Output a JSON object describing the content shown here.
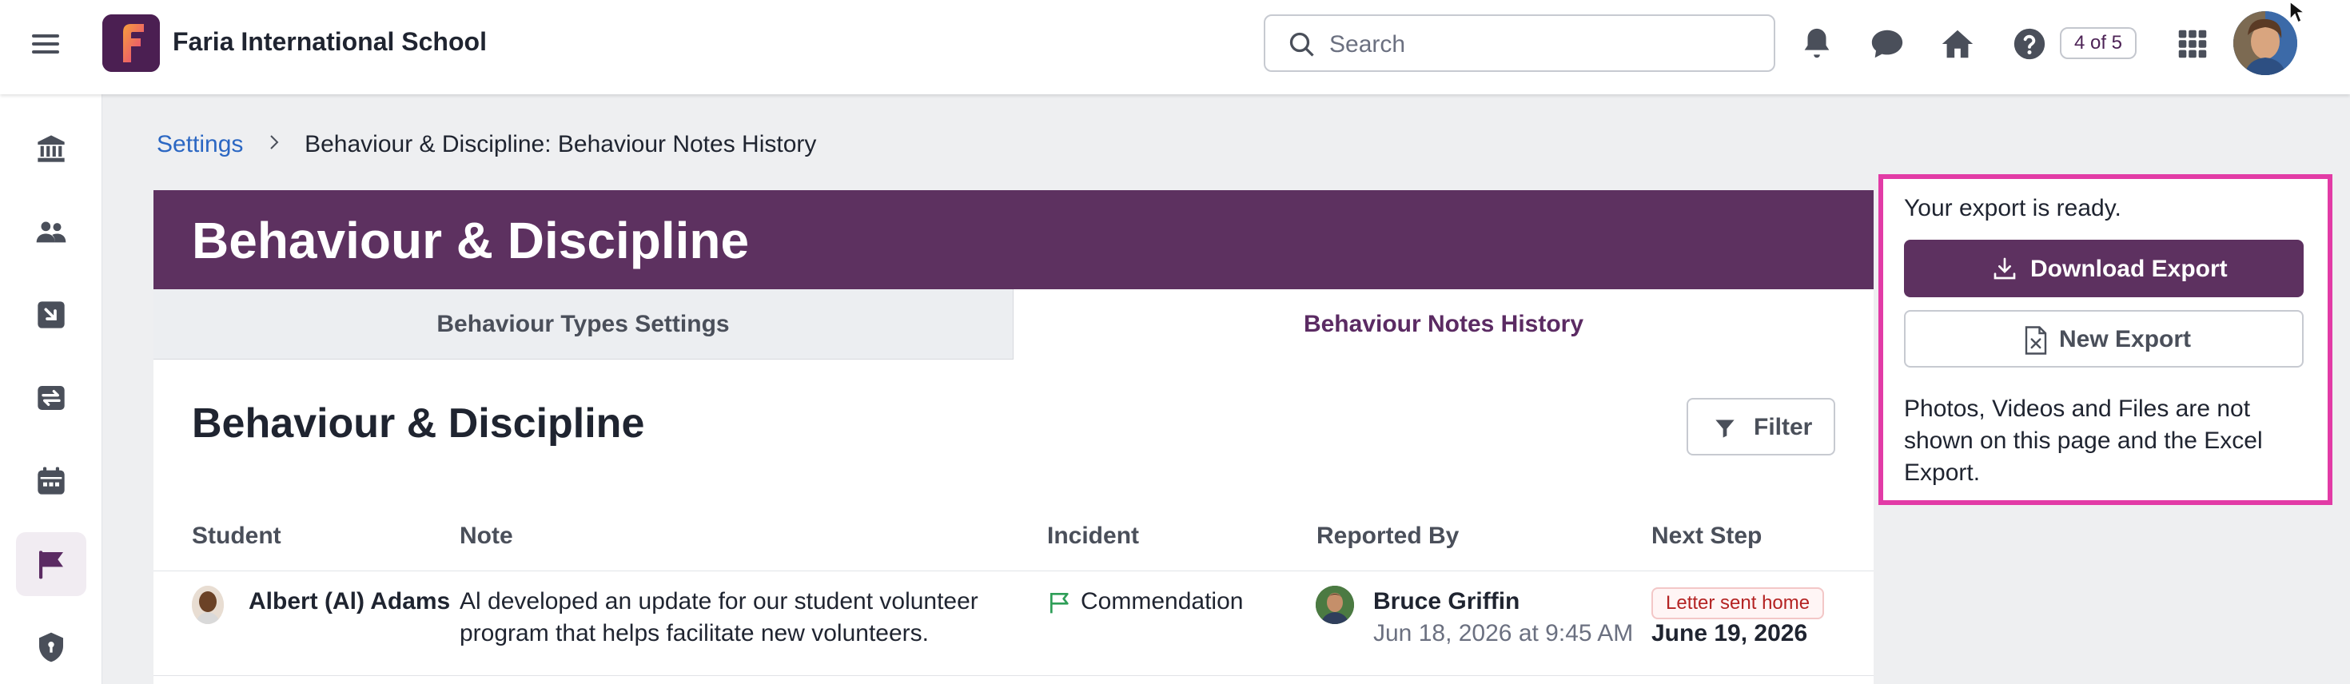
{
  "topbar": {
    "menu_icon": "hamburger-icon",
    "logo_letter": "F",
    "school_name": "Faria International School",
    "search_placeholder": "Search",
    "icons": [
      "bell-icon",
      "chat-icon",
      "home-icon",
      "help-icon",
      "apps-grid-icon"
    ],
    "counter": "4 of 5"
  },
  "sidebar": {
    "items": [
      {
        "icon": "institution-icon",
        "active": false
      },
      {
        "icon": "people-icon",
        "active": false
      },
      {
        "icon": "import-icon",
        "active": false
      },
      {
        "icon": "sync-icon",
        "active": false
      },
      {
        "icon": "calendar-icon",
        "active": false
      },
      {
        "icon": "flag-icon",
        "active": true
      },
      {
        "icon": "shield-icon",
        "active": false
      }
    ]
  },
  "breadcrumb": {
    "link": "Settings",
    "current": "Behaviour & Discipline: Behaviour Notes History"
  },
  "main": {
    "hero_title": "Behaviour & Discipline",
    "tabs": [
      {
        "label": "Behaviour Types Settings",
        "active": false
      },
      {
        "label": "Behaviour Notes History",
        "active": true
      }
    ],
    "section_title": "Behaviour & Discipline",
    "filter_label": "Filter",
    "table": {
      "columns": [
        "Student",
        "Note",
        "Incident",
        "Reported By",
        "Next Step"
      ],
      "rows": [
        {
          "student": "Albert (Al) Adams",
          "note_line1": "Al developed an update for our student volunteer",
          "note_line2": "program that helps facilitate new volunteers.",
          "incident": "Commendation",
          "reporter": "Bruce Griffin",
          "reported_at": "Jun 18, 2026 at 9:45 AM",
          "next_step_badge": "Letter sent home",
          "next_step_date": "June 19, 2026"
        }
      ]
    }
  },
  "export_panel": {
    "ready_text": "Your export is ready.",
    "download_label": "Download Export",
    "new_export_label": "New Export",
    "note": "Photos, Videos and Files are not shown on this page and the Excel Export."
  },
  "colors": {
    "brand_purple": "#5d3160",
    "highlight_pink": "#e23ba6",
    "link_blue": "#2b67c3",
    "badge_red": "#b42323",
    "incident_green": "#2e9e57"
  }
}
